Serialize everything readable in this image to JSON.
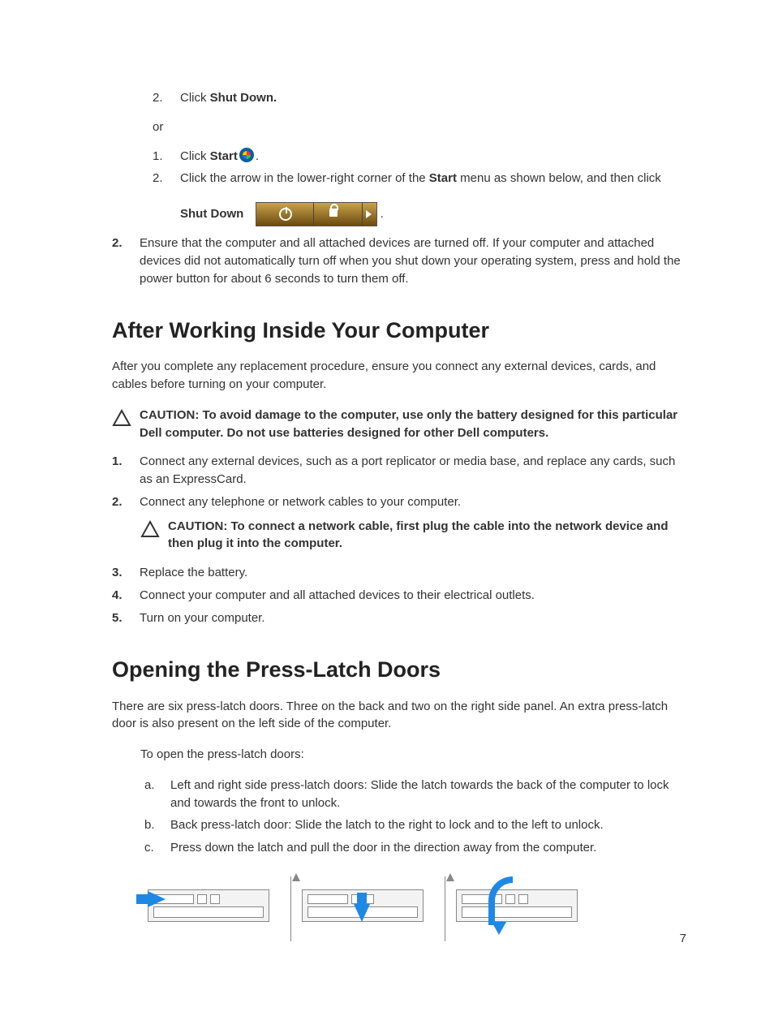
{
  "top": {
    "step2": {
      "num": "2.",
      "pre": "Click ",
      "bold": "Shut Down."
    },
    "or": "or",
    "alt1": {
      "num": "1.",
      "pre": "Click ",
      "bold": "Start",
      "post": "."
    },
    "alt2": {
      "num": "2.",
      "pre": "Click the arrow in the lower-right corner of the ",
      "bold": "Start",
      "post": " menu as shown below, and then click"
    },
    "alt2b_bold": "Shut Down",
    "alt2b_post": " ."
  },
  "outer2": {
    "num": "2.",
    "text": "Ensure that the computer and all attached devices are turned off. If your computer and attached devices did not automatically turn off when you shut down your operating system, press and hold the power button for about 6 seconds to turn them off."
  },
  "h1": "After Working Inside Your Computer",
  "p1": "After you complete any replacement procedure, ensure you connect any external devices, cards, and cables before turning on your computer.",
  "caution1": "CAUTION: To avoid damage to the computer, use only the battery designed for this particular Dell computer. Do not use batteries designed for other Dell computers.",
  "after_steps": {
    "s1": {
      "num": "1.",
      "text": "Connect any external devices, such as a port replicator or media base, and replace any cards, such as an ExpressCard."
    },
    "s2": {
      "num": "2.",
      "text": "Connect any telephone or network cables to your computer."
    },
    "caution2": "CAUTION: To connect a network cable, first plug the cable into the network device and then plug it into the computer.",
    "s3": {
      "num": "3.",
      "text": "Replace the battery."
    },
    "s4": {
      "num": "4.",
      "text": "Connect your computer and all attached devices to their electrical outlets."
    },
    "s5": {
      "num": "5.",
      "text": "Turn on your computer."
    }
  },
  "h2": "Opening the Press-Latch Doors",
  "p2": "There are six press-latch doors. Three on the back and two on the right side panel. An extra press-latch door is also present on the left side of the computer.",
  "p3": "To open the press-latch doors:",
  "letters": {
    "a": {
      "m": "a.",
      "t": "Left and right side press-latch doors: Slide the latch towards the back of the computer to lock and towards the front to unlock."
    },
    "b": {
      "m": "b.",
      "t": "Back press-latch door: Slide the latch to the right to lock and to the left to unlock."
    },
    "c": {
      "m": "c.",
      "t": "Press down the latch and pull the door in the direction away from the computer."
    }
  },
  "page_number": "7"
}
